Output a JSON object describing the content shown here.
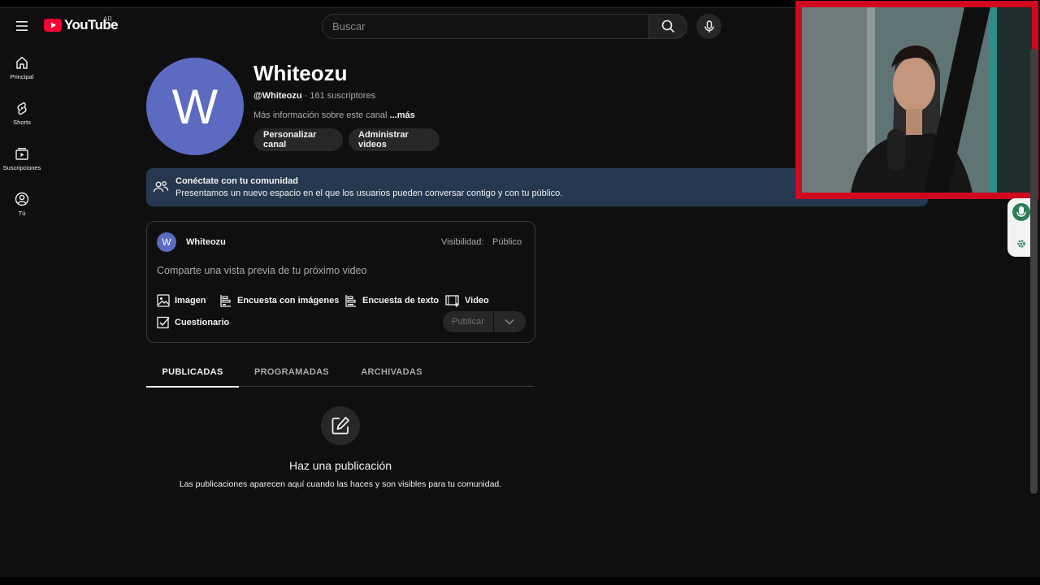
{
  "header": {
    "logo_text": "YouTube",
    "country_code": "AR",
    "search_placeholder": "Buscar"
  },
  "sidebar": {
    "items": [
      {
        "label": "Principal",
        "icon": "home-icon"
      },
      {
        "label": "Shorts",
        "icon": "shorts-icon"
      },
      {
        "label": "Suscripciones",
        "icon": "subscriptions-icon"
      },
      {
        "label": "Tú",
        "icon": "account-icon"
      }
    ]
  },
  "channel": {
    "avatar_letter": "W",
    "name": "Whiteozu",
    "handle": "@Whiteozu",
    "subscribers": " · 161 suscriptores",
    "more_info": "Más información sobre este canal ",
    "more_link": "...más",
    "customize_button": "Personalizar canal",
    "manage_button": "Administrar videos"
  },
  "banner": {
    "title": "Conéctate con tu comunidad",
    "description": "Presentamos un nuevo espacio en el que los usuarios pueden conversar contigo y con tu público."
  },
  "composer": {
    "avatar_letter": "W",
    "author": "Whiteozu",
    "visibility_label": "Visibilidad:",
    "visibility_value": "Público",
    "placeholder": "Comparte una vista previa de tu próximo video",
    "tools": {
      "image": "Imagen",
      "image_poll": "Encuesta con imágenes",
      "text_poll": "Encuesta de texto",
      "video": "Video",
      "quiz": "Cuestionario"
    },
    "publish_button": "Publicar"
  },
  "tabs": [
    {
      "label": "PUBLICADAS",
      "active": true
    },
    {
      "label": "PROGRAMADAS",
      "active": false
    },
    {
      "label": "ARCHIVADAS",
      "active": false
    }
  ],
  "empty_state": {
    "title": "Haz una publicación",
    "description": "Las publicaciones aparecen aquí cuando las haces y son visibles para tu comunidad."
  },
  "colors": {
    "background": "#0f0f0f",
    "brand_red": "#ff0033",
    "avatar": "#5c6bc0",
    "banner": "#263850",
    "webcam_border": "#d0091e"
  }
}
